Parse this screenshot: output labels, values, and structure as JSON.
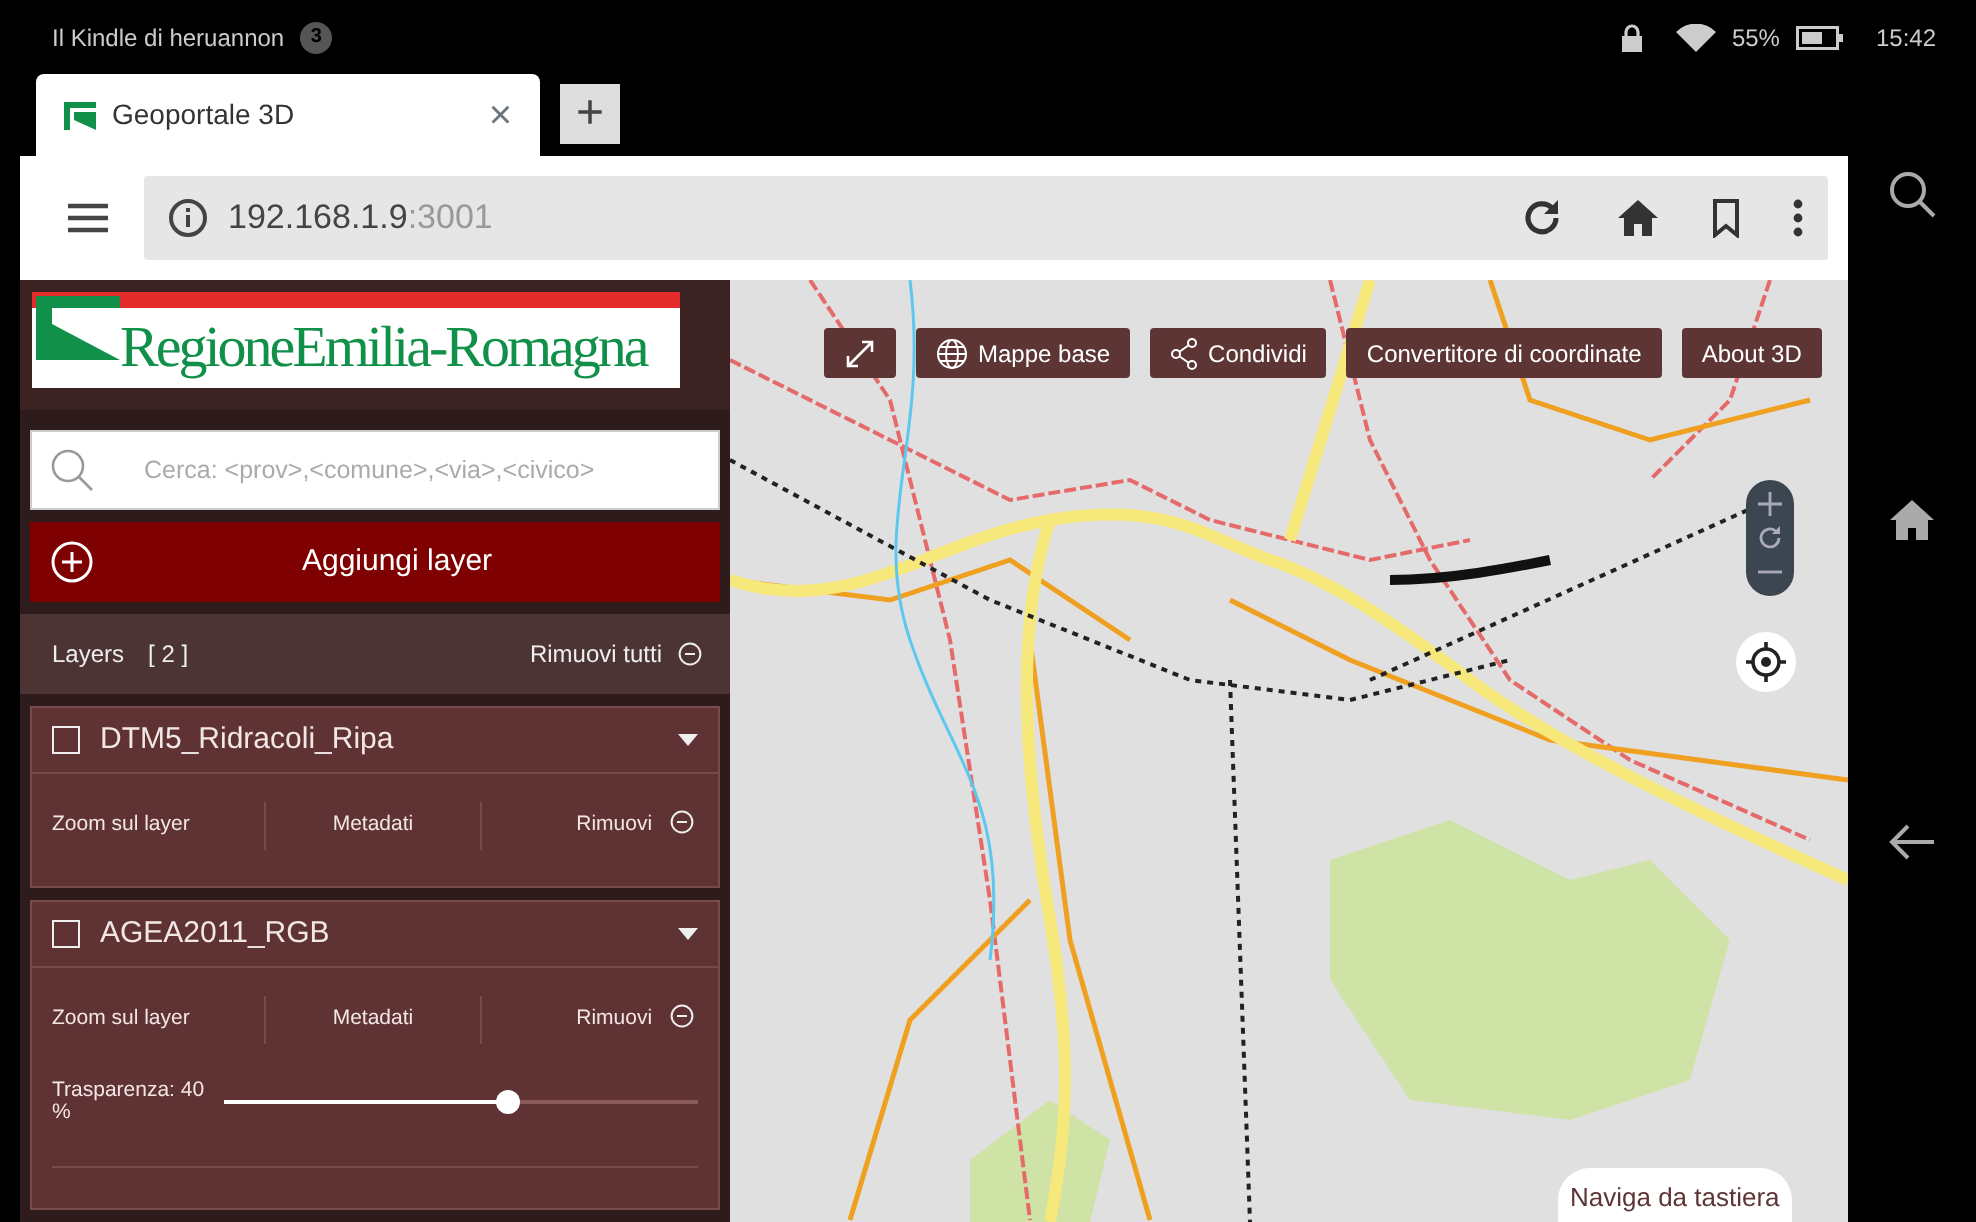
{
  "status_bar": {
    "device_name": "Il Kindle di heruannon",
    "notification_count": "3",
    "battery": "55%",
    "time": "15:42"
  },
  "browser": {
    "tabs": [
      {
        "title": "Geoportale 3D",
        "selected": true,
        "close": "×"
      }
    ],
    "new_tab": "+",
    "url_host": "192.168.1.9",
    "url_port": ":3001"
  },
  "sidebar": {
    "logo_text": "RegioneEmilia-Romagna",
    "search": {
      "placeholder": "Cerca: <prov>,<comune>,<via>,<civico>"
    },
    "add_layer": "Aggiungi layer",
    "layers_header": {
      "title": "Layers",
      "count": "[ 2 ]",
      "remove_all": "Rimuovi tutti"
    },
    "layers": [
      {
        "name": "DTM5_Ridracoli_Ripa",
        "checked": false,
        "actions": [
          "Zoom sul layer",
          "Metadati",
          "Rimuovi"
        ]
      },
      {
        "name": "AGEA2011_RGB",
        "checked": false,
        "actions": [
          "Zoom sul layer",
          "Metadati",
          "Rimuovi"
        ],
        "slider": {
          "label": "Trasparenza: 40 %",
          "level": 0.6
        }
      }
    ]
  },
  "map": {
    "kind": "picture",
    "toolbar": [
      "Mappe base",
      "Condividi",
      "Convertitore di coordinate",
      "About 3D"
    ],
    "keyboard_nav": "Naviga da tastiera"
  }
}
